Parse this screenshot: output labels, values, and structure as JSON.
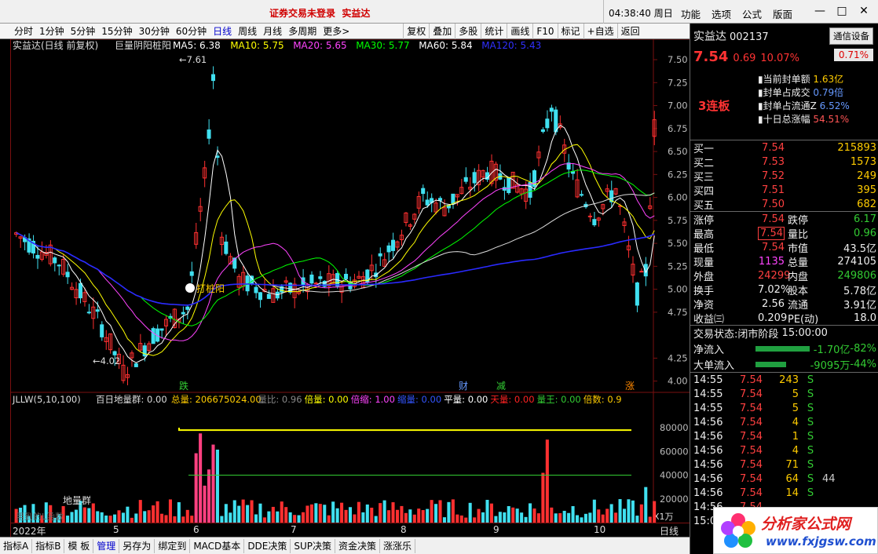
{
  "topbar": {
    "warning": "证券交易未登录",
    "stock": "实益达",
    "clock": "04:38:40",
    "weekday": "周日",
    "menu": [
      "功能",
      "选项",
      "公式",
      "版面"
    ],
    "win": [
      "—",
      "□",
      "✕"
    ]
  },
  "toolbar": {
    "first": " ",
    "periods": [
      "分时",
      "1分钟",
      "5分钟",
      "15分钟",
      "30分钟",
      "60分钟",
      "日线",
      "周线",
      "月线",
      "多周期",
      "更多>"
    ],
    "tools": [
      "复权",
      "叠加",
      "多股",
      "统计",
      "画线",
      "F10",
      "标记",
      "+自选",
      "返回"
    ]
  },
  "main": {
    "title": "实益达(日线 前复权)",
    "indicator": "巨量阴阳桩阳",
    "ma": [
      {
        "l": "MA5: 6.38",
        "c": "#ffffff"
      },
      {
        "l": "MA10: 5.75",
        "c": "#ffff00"
      },
      {
        "l": "MA20: 5.65",
        "c": "#ff44ff"
      },
      {
        "l": "MA30: 5.77",
        "c": "#00ff00"
      },
      {
        "l": "MA60: 5.84",
        "c": "#ffffff"
      },
      {
        "l": "MA120: 5.43",
        "c": "#3030ff"
      }
    ],
    "high_label": "7.61",
    "low_label": "4.02",
    "signal_label": "打桩阳",
    "yticks": [
      "7.50",
      "7.25",
      "7.00",
      "6.75",
      "6.50",
      "6.25",
      "6.00",
      "5.75",
      "5.50",
      "5.25",
      "5.00",
      "4.75",
      "4.25",
      "4.00"
    ],
    "event_labels": [
      "跌",
      "财",
      "减",
      "涨"
    ]
  },
  "sub": {
    "name": "JLLW(5,10,100)",
    "title": "百日地量群: 0.00",
    "fields": [
      {
        "l": "总量: 206675024.00",
        "c": "#ffcc00"
      },
      {
        "l": "量比: 0.96",
        "c": "#888888"
      },
      {
        "l": "倍量: 0.00",
        "c": "#ffff00"
      },
      {
        "l": "倍缩: 1.00",
        "c": "#ff44ff"
      },
      {
        "l": "缩量: 0.00",
        "c": "#3355ff"
      },
      {
        "l": "平量: 0.00",
        "c": "#ffffff"
      },
      {
        "l": "天量: 0.00",
        "c": "#ff2222"
      },
      {
        "l": "量王: 0.00",
        "c": "#33cc33"
      },
      {
        "l": "倍数: 0.9",
        "c": "#ffcc00"
      }
    ],
    "yticks": [
      "80000",
      "60000",
      "40000",
      "20000"
    ],
    "unit": "X1万",
    "group_label": "地量群",
    "watermark": "用到的L函数"
  },
  "xaxis": {
    "labels": [
      "2022年",
      "5",
      "6",
      "7",
      "8",
      "9",
      "10"
    ],
    "period": "日线"
  },
  "bottombar": {
    "tabs": [
      "指标A",
      "指标B",
      "模 板",
      "管理",
      "另存为",
      "绑定到",
      "MACD基本",
      "DDE决策",
      "SUP决策",
      "资金决策",
      "涨涨乐"
    ]
  },
  "panel": {
    "name": "实益达",
    "code": "002137",
    "button": "通信设备",
    "price": "7.54",
    "change": "0.69",
    "pct": "10.07%",
    "badge": "0.71%",
    "streak": "3连板",
    "seal": [
      {
        "k": "当前封单额",
        "v": "1.63亿",
        "c": "v"
      },
      {
        "k": "封单占成交",
        "v": "0.79倍",
        "c": "vb"
      },
      {
        "k": "封单占流通Z",
        "v": "6.52%",
        "c": "vb"
      },
      {
        "k": "十日总涨幅",
        "v": "54.51%",
        "c": "vr"
      }
    ],
    "book": [
      {
        "l": "买一",
        "p": "7.54",
        "q": "215893"
      },
      {
        "l": "买二",
        "p": "7.53",
        "q": "1573"
      },
      {
        "l": "买三",
        "p": "7.52",
        "q": "249"
      },
      {
        "l": "买四",
        "p": "7.51",
        "q": "395"
      },
      {
        "l": "买五",
        "p": "7.50",
        "q": "682"
      }
    ],
    "stats": [
      {
        "a": "涨停",
        "b": "7.54",
        "bc": "red",
        "c": "跌停",
        "d": "6.17",
        "dc": "green"
      },
      {
        "a": "最高",
        "b": "7.54",
        "bc": "red boxed",
        "c": "量比",
        "d": "0.96",
        "dc": "green"
      },
      {
        "a": "最低",
        "b": "7.54",
        "bc": "red",
        "c": "市值",
        "d": "43.5亿",
        "dc": "white"
      },
      {
        "a": "现量",
        "b": "1135",
        "bc": "purple",
        "c": "总量",
        "d": "274105",
        "dc": "white"
      },
      {
        "a": "外盘",
        "b": "24299",
        "bc": "red",
        "c": "内盘",
        "d": "249806",
        "dc": "green"
      },
      {
        "a": "换手",
        "b": "7.02%",
        "bc": "white",
        "c": "股本",
        "d": "5.78亿",
        "dc": "white"
      },
      {
        "a": "净资",
        "b": "2.56",
        "bc": "white",
        "c": "流通",
        "d": "3.91亿",
        "dc": "white"
      },
      {
        "a": "收益㈢",
        "b": "0.209",
        "bc": "white",
        "c": "PE(动)",
        "d": "18.0",
        "dc": "white"
      }
    ],
    "state_label": "交易状态:",
    "state": "闭市阶段",
    "state_time": "15:00:00",
    "flows": [
      {
        "l": "净流入",
        "v": "-1.70亿",
        "p": "-82%"
      },
      {
        "l": "大单流入",
        "v": "-9095万",
        "p": "-44%"
      }
    ],
    "ticks": [
      {
        "t": "14:55",
        "p": "7.54",
        "v": "243",
        "s": "S"
      },
      {
        "t": "14:55",
        "p": "7.54",
        "v": "5",
        "s": "S"
      },
      {
        "t": "14:55",
        "p": "7.54",
        "v": "5",
        "s": "S"
      },
      {
        "t": "14:56",
        "p": "7.54",
        "v": "4",
        "s": "S"
      },
      {
        "t": "14:56",
        "p": "7.54",
        "v": "1",
        "s": "S"
      },
      {
        "t": "14:56",
        "p": "7.54",
        "v": "4",
        "s": "S"
      },
      {
        "t": "14:56",
        "p": "7.54",
        "v": "71",
        "s": "S"
      },
      {
        "t": "14:56",
        "p": "7.54",
        "v": "64",
        "s": "S",
        "n": "44"
      },
      {
        "t": "14:56",
        "p": "7.54",
        "v": "14",
        "s": "S"
      },
      {
        "t": "14:56",
        "p": "7.54",
        "v": "",
        "s": ""
      },
      {
        "t": "15:00",
        "p": "",
        "v": "",
        "s": ""
      }
    ]
  },
  "logo": {
    "title": "分析家公式网",
    "url": "www.fxjgsw.com"
  },
  "chart_data": {
    "type": "candlestick",
    "title": "实益达(日线 前复权)",
    "ylim": [
      4.0,
      7.61
    ],
    "high": 7.61,
    "low": 4.02,
    "last_close": 7.54,
    "volume_ylim": [
      0,
      80000
    ],
    "volume_unit": "X1万"
  }
}
